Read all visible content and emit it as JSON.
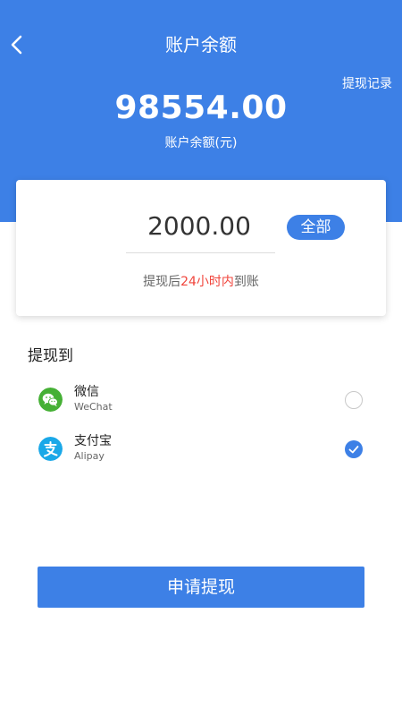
{
  "header": {
    "title": "账户余额",
    "record_link": "提现记录",
    "balance_amount": "98554.00",
    "balance_label": "账户余额(元)"
  },
  "card": {
    "amount": "2000.00",
    "all_button": "全部",
    "note_prefix": "提现后",
    "note_highlight": "24小时内",
    "note_suffix": "到账"
  },
  "withdraw_to": {
    "title": "提现到",
    "options": [
      {
        "name": "微信",
        "sub": "WeChat",
        "icon": "wechat-icon",
        "selected": false
      },
      {
        "name": "支付宝",
        "sub": "Alipay",
        "icon": "alipay-icon",
        "selected": true
      }
    ]
  },
  "submit_button": "申请提现",
  "colors": {
    "primary": "#3d80e6",
    "highlight": "#f0443b",
    "wechat": "#45b035",
    "alipay": "#1aa8e8"
  }
}
